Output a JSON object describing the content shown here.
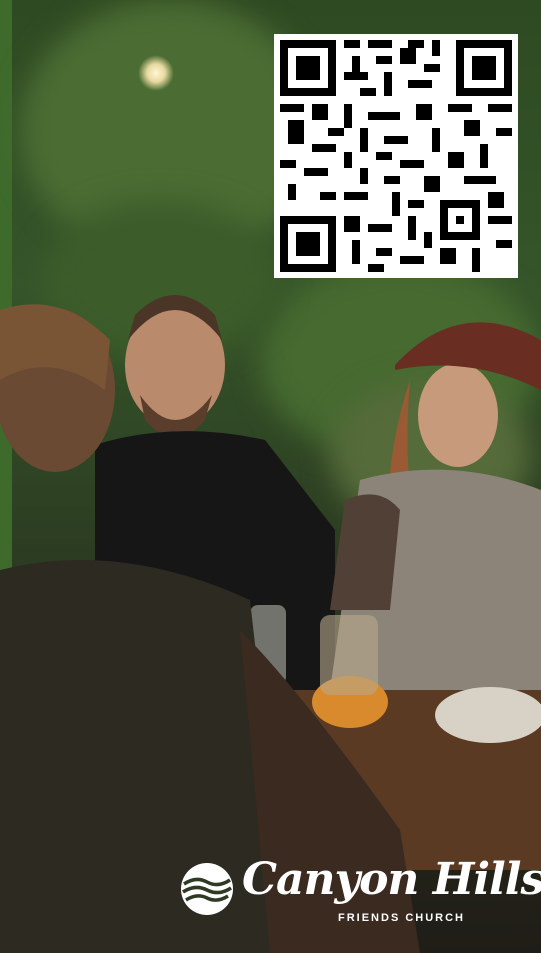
{
  "brand": {
    "name": "Canyon Hills",
    "subtitle": "FRIENDS CHURCH"
  },
  "colors": {
    "accent_green": "#3e6b2c",
    "logo_white": "#ffffff"
  },
  "icons": {
    "qr": "qr-code-icon",
    "logo_mark": "wave-logo-icon"
  }
}
